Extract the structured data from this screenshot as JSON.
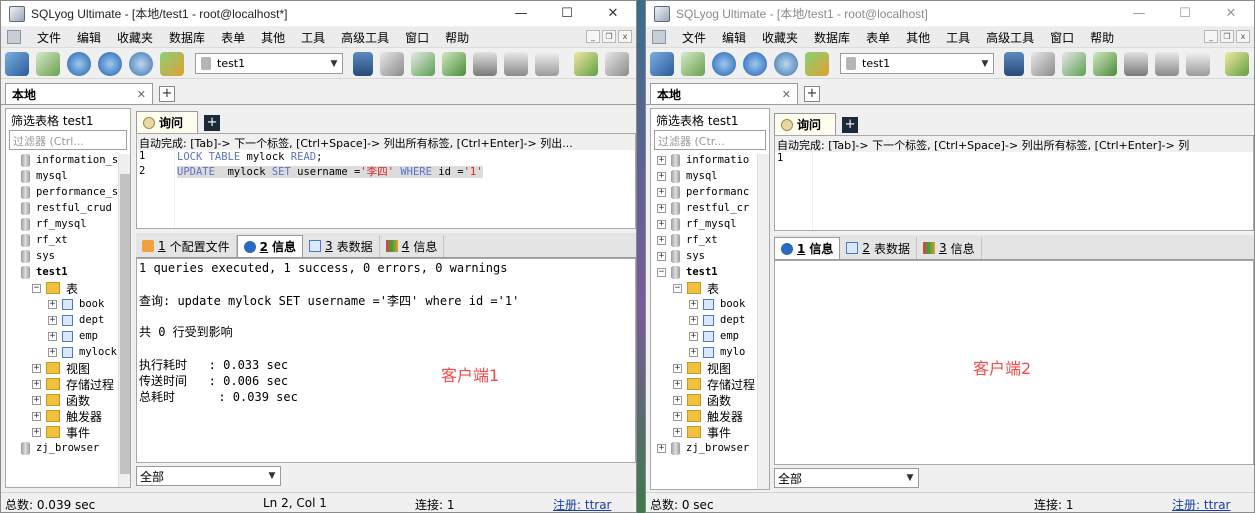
{
  "windows": [
    {
      "title": "SQLyog Ultimate - [本地/test1 - root@localhost*]",
      "active": true,
      "menu": [
        "文件",
        "编辑",
        "收藏夹",
        "数据库",
        "表单",
        "其他",
        "工具",
        "高级工具",
        "窗口",
        "帮助"
      ],
      "db_selector": "test1",
      "connection_tab": "本地",
      "tree_title": "筛选表格 test1",
      "filter_placeholder": "过滤器 (Ctrl...",
      "tree": [
        {
          "label": "information_s",
          "level": 0,
          "type": "db",
          "expand": ""
        },
        {
          "label": "mysql",
          "level": 0,
          "type": "db",
          "expand": ""
        },
        {
          "label": "performance_s",
          "level": 0,
          "type": "db",
          "expand": ""
        },
        {
          "label": "restful_crud",
          "level": 0,
          "type": "db",
          "expand": ""
        },
        {
          "label": "rf_mysql",
          "level": 0,
          "type": "db",
          "expand": ""
        },
        {
          "label": "rf_xt",
          "level": 0,
          "type": "db",
          "expand": ""
        },
        {
          "label": "sys",
          "level": 0,
          "type": "db",
          "expand": ""
        },
        {
          "label": "test1",
          "level": 0,
          "type": "db-bold",
          "expand": ""
        },
        {
          "label": "表",
          "level": 1,
          "type": "folder",
          "expand": "−"
        },
        {
          "label": "book",
          "level": 2,
          "type": "table",
          "expand": "+"
        },
        {
          "label": "dept",
          "level": 2,
          "type": "table",
          "expand": "+"
        },
        {
          "label": "emp",
          "level": 2,
          "type": "table",
          "expand": "+"
        },
        {
          "label": "mylock",
          "level": 2,
          "type": "table",
          "expand": "+"
        },
        {
          "label": "视图",
          "level": 1,
          "type": "folder",
          "expand": "+"
        },
        {
          "label": "存储过程",
          "level": 1,
          "type": "folder",
          "expand": "+"
        },
        {
          "label": "函数",
          "level": 1,
          "type": "folder",
          "expand": "+"
        },
        {
          "label": "触发器",
          "level": 1,
          "type": "folder",
          "expand": "+"
        },
        {
          "label": "事件",
          "level": 1,
          "type": "folder",
          "expand": "+"
        },
        {
          "label": "zj_browser",
          "level": 0,
          "type": "db",
          "expand": ""
        }
      ],
      "query_tab": "询问",
      "autocomplete_hint": "自动完成: [Tab]-> 下一个标签, [Ctrl+Space]-> 列出所有标签, [Ctrl+Enter]-> 列出...",
      "line_numbers": [
        "1",
        "2"
      ],
      "result_tabs": [
        {
          "num": "1",
          "label": "个配置文件",
          "active": false
        },
        {
          "num": "2",
          "label": "信息",
          "active": true
        },
        {
          "num": "3",
          "label": "表数据",
          "active": false
        },
        {
          "num": "4",
          "label": "信息",
          "active": false
        }
      ],
      "results": {
        "summary": "1 queries executed, 1 success, 0 errors, 0 warnings",
        "query": "查询: update mylock SET username ='李四' where id ='1'",
        "affected": "共 0 行受到影响",
        "exec_time": "执行耗时   : 0.033 sec",
        "transfer_time": "传送时间   : 0.006 sec",
        "total_time": "总耗时      : 0.039 sec"
      },
      "client_label": "客户端1",
      "filter_select": "全部",
      "status": {
        "total": "总数: 0.039 sec",
        "position": "Ln 2, Col 1",
        "connections": "连接: 1",
        "register": "注册: ttrar"
      }
    },
    {
      "title": "SQLyog Ultimate - [本地/test1 - root@localhost]",
      "active": false,
      "menu": [
        "文件",
        "编辑",
        "收藏夹",
        "数据库",
        "表单",
        "其他",
        "工具",
        "高级工具",
        "窗口",
        "帮助"
      ],
      "db_selector": "test1",
      "connection_tab": "本地",
      "tree_title": "筛选表格 test1",
      "filter_placeholder": "过滤器 (Ctr...",
      "tree": [
        {
          "label": "informatio",
          "level": 0,
          "type": "db",
          "expand": "+"
        },
        {
          "label": "mysql",
          "level": 0,
          "type": "db",
          "expand": "+"
        },
        {
          "label": "performanc",
          "level": 0,
          "type": "db",
          "expand": "+"
        },
        {
          "label": "restful_cr",
          "level": 0,
          "type": "db",
          "expand": "+"
        },
        {
          "label": "rf_mysql",
          "level": 0,
          "type": "db",
          "expand": "+"
        },
        {
          "label": "rf_xt",
          "level": 0,
          "type": "db",
          "expand": "+"
        },
        {
          "label": "sys",
          "level": 0,
          "type": "db",
          "expand": "+"
        },
        {
          "label": "test1",
          "level": 0,
          "type": "db-bold",
          "expand": "−"
        },
        {
          "label": "表",
          "level": 1,
          "type": "folder",
          "expand": "−"
        },
        {
          "label": "book",
          "level": 2,
          "type": "table",
          "expand": "+"
        },
        {
          "label": "dept",
          "level": 2,
          "type": "table",
          "expand": "+"
        },
        {
          "label": "emp",
          "level": 2,
          "type": "table",
          "expand": "+"
        },
        {
          "label": "mylo",
          "level": 2,
          "type": "table",
          "expand": "+"
        },
        {
          "label": "视图",
          "level": 1,
          "type": "folder",
          "expand": "+"
        },
        {
          "label": "存储过程",
          "level": 1,
          "type": "folder",
          "expand": "+"
        },
        {
          "label": "函数",
          "level": 1,
          "type": "folder",
          "expand": "+"
        },
        {
          "label": "触发器",
          "level": 1,
          "type": "folder",
          "expand": "+"
        },
        {
          "label": "事件",
          "level": 1,
          "type": "folder",
          "expand": "+"
        },
        {
          "label": "zj_browser",
          "level": 0,
          "type": "db",
          "expand": "+"
        }
      ],
      "query_tab": "询问",
      "autocomplete_hint": "自动完成: [Tab]-> 下一个标签, [Ctrl+Space]-> 列出所有标签, [Ctrl+Enter]-> 列",
      "line_numbers": [
        "1"
      ],
      "result_tabs": [
        {
          "num": "1",
          "label": "信息",
          "active": true
        },
        {
          "num": "2",
          "label": "表数据",
          "active": false
        },
        {
          "num": "3",
          "label": "信息",
          "active": false
        }
      ],
      "client_label": "客户端2",
      "filter_select": "全部",
      "status": {
        "total": "总数: 0 sec",
        "connections": "连接: 1",
        "register": "注册: ttrar"
      }
    }
  ],
  "window_buttons": {
    "minimize": "—",
    "maximize": "☐",
    "close": "✕"
  },
  "editor_w1": {
    "line1": {
      "kw1": "LOCK TABLE",
      "t1": " mylock ",
      "kw2": "READ",
      ";": ";"
    },
    "line2": {
      "kw1": "UPDATE",
      "t1": "  mylock ",
      "kw2": "SET",
      "t2": " username =",
      "s1": "'李四'",
      "t3": " ",
      "kw3": "WHERE",
      "t4": " id =",
      "s2": "'1'"
    }
  },
  "colors": {
    "keyword": "#5d72c8",
    "string": "#d22222",
    "client_label": "#f34a4a",
    "link": "#1a3ea8"
  }
}
